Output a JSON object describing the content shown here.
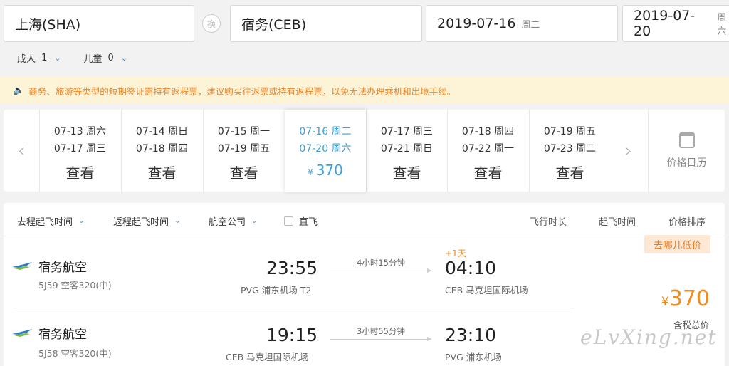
{
  "search": {
    "from": "上海(SHA)",
    "swap": "换",
    "to": "宿务(CEB)",
    "depart_date": "2019-07-16",
    "depart_week": "周二",
    "return_date": "2019-07-20",
    "return_week": "周六"
  },
  "passengers": {
    "adult_label": "成人",
    "adult_count": "1",
    "child_label": "儿童",
    "child_count": "0"
  },
  "notice": "商务、旅游等类型的短期签证需持有返程票，建议购买往返票或持有返程票，以免无法办理乘机和出境手续。",
  "date_strip": {
    "cells": [
      {
        "d1": "07-13 周六",
        "d2": "07-17 周三",
        "look": "查看"
      },
      {
        "d1": "07-14 周日",
        "d2": "07-18 周四",
        "look": "查看"
      },
      {
        "d1": "07-15 周一",
        "d2": "07-19 周五",
        "look": "查看"
      },
      {
        "d1": "07-16 周二",
        "d2": "07-20 周六",
        "yen": "¥",
        "look": "370"
      },
      {
        "d1": "07-17 周三",
        "d2": "07-21 周日",
        "look": "查看"
      },
      {
        "d1": "07-18 周四",
        "d2": "07-22 周一",
        "look": "查看"
      },
      {
        "d1": "07-19 周五",
        "d2": "07-23 周二",
        "look": "查看"
      }
    ],
    "calendar_label": "价格日历"
  },
  "filters": {
    "outbound_time": "去程起飞时间",
    "return_time": "返程起飞时间",
    "airline": "航空公司",
    "direct": "直飞",
    "sort_duration": "飞行时长",
    "sort_depart": "起飞时间",
    "sort_price": "价格排序"
  },
  "flights": [
    {
      "airline": "宿务航空",
      "flight_no": "5J59 空客320(中)",
      "dep_time": "23:55",
      "dep_airport": "PVG 浦东机场 T2",
      "duration": "4小时15分钟",
      "next_day": "+1天",
      "arr_time": "04:10",
      "arr_airport": "CEB 马克坦国际机场"
    },
    {
      "airline": "宿务航空",
      "flight_no": "5J58 空客320(中)",
      "dep_time": "19:15",
      "dep_airport": "CEB 马克坦国际机场",
      "duration": "3小时55分钟",
      "arr_time": "23:10",
      "arr_airport": "PVG 浦东机场"
    }
  ],
  "offer": {
    "badge": "去哪儿低价",
    "currency": "¥",
    "price": "370",
    "price_note": "含税总价"
  },
  "watermark": "eLvXing.net",
  "colors": {
    "accent_blue": "#3d9fd6",
    "price_orange": "#f08c1e",
    "notice_bg": "#fdf3d6"
  }
}
